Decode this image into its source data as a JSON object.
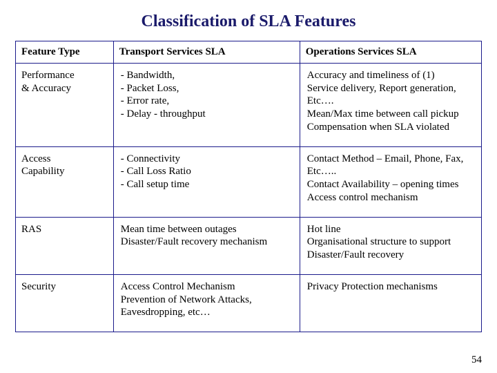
{
  "title": "Classification of SLA Features",
  "headers": {
    "col1": "Feature Type",
    "col2": "Transport Services SLA",
    "col3": "Operations Services SLA"
  },
  "rows": [
    {
      "feature": "Performance\n& Accuracy",
      "transport": " - Bandwidth,\n - Packet Loss,\n - Error rate,\n - Delay - throughput",
      "operations": "Accuracy and timeliness of (1)\nService delivery, Report generation,\nEtc….\nMean/Max time between call pickup\nCompensation when SLA violated"
    },
    {
      "feature": "Access\nCapability",
      "transport": "  - Connectivity\n  - Call Loss Ratio\n  - Call setup time",
      "operations": "Contact Method – Email, Phone, Fax,\nEtc…..\nContact Availability – opening times\nAccess control mechanism"
    },
    {
      "feature": "RAS",
      "transport": " Mean time between outages\n Disaster/Fault recovery mechanism",
      "operations": " Hot line\n Organisational structure to support\n Disaster/Fault recovery"
    },
    {
      "feature": "Security",
      "transport": " Access Control Mechanism\n Prevention of Network Attacks,\n Eavesdropping, etc…",
      "operations": " Privacy Protection mechanisms"
    }
  ],
  "page_number": "54"
}
